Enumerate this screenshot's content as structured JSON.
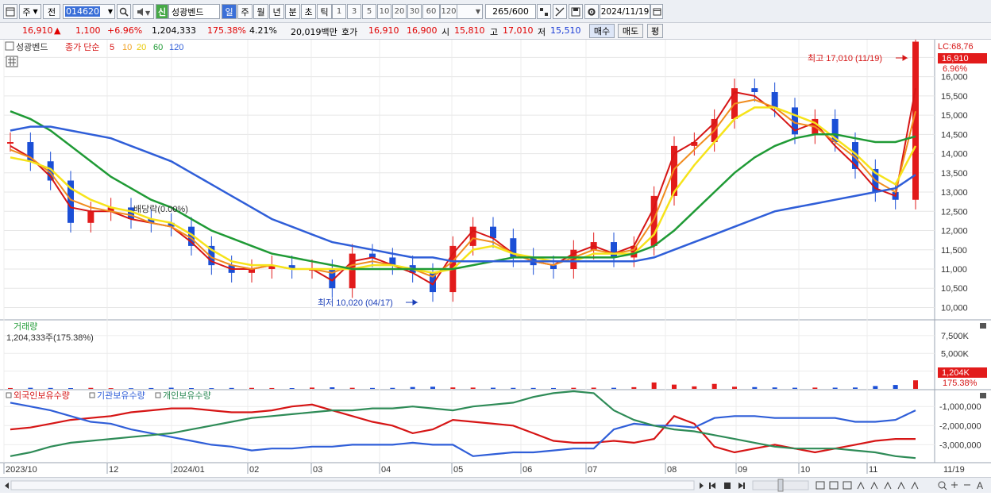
{
  "toolbar": {
    "market_btn": "주",
    "prev_btn": "전",
    "stock_code": "014620",
    "new_badge": "신",
    "stock_name": "성광벤드",
    "periods": [
      "일",
      "주",
      "월",
      "년",
      "분",
      "초",
      "틱"
    ],
    "active_period": "일",
    "intervals": [
      "1",
      "3",
      "5",
      "10",
      "20",
      "30",
      "60",
      "120"
    ],
    "count_value": "265",
    "count_total": "/600",
    "date_value": "2024/11/19"
  },
  "quote": {
    "price": "16,910",
    "arrow": "▲",
    "change": "1,100",
    "change_pct": "+6.96%",
    "volume": "1,204,333",
    "volume_ratio": "175.38%",
    "turnover": "4.21%",
    "amount": "20,019백만",
    "ask_label": "호가",
    "ask": "16,910",
    "bid": "16,900",
    "open_label": "시",
    "open": "15,810",
    "high_label": "고",
    "high": "17,010",
    "low_label": "저",
    "low": "15,510",
    "buy_btn": "매수",
    "sell_btn": "매도",
    "eval_btn": "평"
  },
  "price_panel": {
    "stock_label": "성광벤드",
    "series_label": "종가 단순",
    "ma_periods": [
      "5",
      "10",
      "20",
      "60",
      "120"
    ],
    "lc_label": "LC:68,76",
    "current_price": "16,910",
    "current_pct": "6.96%",
    "high_annotation": "최고 17,010 (11/19)",
    "low_annotation": "최저 10,020 (04/17)",
    "dividend_annotation": "배당락(0.00%)",
    "y_ticks": [
      "16,500",
      "16,000",
      "15,500",
      "15,000",
      "14,500",
      "14,000",
      "13,500",
      "13,000",
      "12,500",
      "12,000",
      "11,500",
      "11,000",
      "10,500",
      "10,000"
    ]
  },
  "volume_panel": {
    "title": "거래량",
    "value": "1,204,333주(175.38%)",
    "y_ticks": [
      "7,500K",
      "5,000K",
      "2,500K"
    ],
    "current": "1,204K",
    "current_pct": "175.38%"
  },
  "holdings_panel": {
    "series_labels": [
      "외국인보유수량",
      "기관보유수량",
      "개인보유수량"
    ],
    "y_ticks": [
      "-1,000,000",
      "-2,000,000",
      "-3,000,000"
    ]
  },
  "x_axis": {
    "labels": [
      "2023/10",
      "12",
      "2024/01",
      "02",
      "03",
      "04",
      "05",
      "06",
      "07",
      "08",
      "09",
      "10",
      "11"
    ],
    "right_label": "11/19"
  },
  "chart_data": {
    "type": "line",
    "title": "성광벤드",
    "series": [
      {
        "name": "종가",
        "values": [
          14.3,
          13.8,
          13.3,
          12.2,
          12.5,
          12.6,
          12.3,
          12.2,
          12.1,
          11.6,
          11.1,
          10.9,
          11.0,
          11.1,
          11.0,
          11.0,
          10.5,
          11.4,
          11.3,
          11.1,
          10.9,
          10.4,
          11.6,
          12.1,
          11.8,
          11.3,
          11.1,
          11.0,
          11.5,
          11.7,
          11.3,
          11.6,
          12.9,
          14.2,
          14.3,
          14.9,
          15.7,
          15.6,
          15.2,
          14.5,
          14.9,
          14.3,
          13.6,
          13.0,
          12.8,
          16.91
        ]
      },
      {
        "name": "5",
        "values": [
          14.2,
          13.9,
          13.4,
          12.6,
          12.5,
          12.5,
          12.3,
          12.2,
          12.1,
          11.7,
          11.2,
          11.0,
          11.0,
          11.1,
          11.0,
          11.0,
          10.7,
          11.2,
          11.3,
          11.1,
          10.9,
          10.6,
          11.4,
          12.0,
          11.8,
          11.4,
          11.2,
          11.1,
          11.4,
          11.6,
          11.4,
          11.6,
          12.6,
          14.0,
          14.3,
          14.8,
          15.6,
          15.5,
          15.1,
          14.6,
          14.8,
          14.2,
          13.7,
          13.1,
          12.9,
          15.7
        ]
      },
      {
        "name": "10",
        "values": [
          14.1,
          13.9,
          13.5,
          12.8,
          12.6,
          12.5,
          12.4,
          12.2,
          12.1,
          11.8,
          11.3,
          11.1,
          11.0,
          11.1,
          11.0,
          11.0,
          10.9,
          11.1,
          11.2,
          11.1,
          11.0,
          10.8,
          11.2,
          11.8,
          11.7,
          11.4,
          11.2,
          11.1,
          11.3,
          11.5,
          11.4,
          11.5,
          12.3,
          13.6,
          14.1,
          14.6,
          15.3,
          15.4,
          15.2,
          14.8,
          14.7,
          14.3,
          13.9,
          13.3,
          13.0,
          15.1
        ]
      },
      {
        "name": "20",
        "values": [
          13.9,
          13.8,
          13.6,
          13.1,
          12.8,
          12.6,
          12.5,
          12.3,
          12.2,
          11.9,
          11.5,
          11.2,
          11.1,
          11.1,
          11.0,
          11.0,
          11.0,
          11.0,
          11.1,
          11.1,
          11.0,
          10.9,
          11.0,
          11.5,
          11.6,
          11.4,
          11.3,
          11.2,
          11.2,
          11.4,
          11.4,
          11.4,
          11.9,
          13.0,
          13.7,
          14.3,
          14.9,
          15.2,
          15.2,
          15.0,
          14.8,
          14.4,
          14.0,
          13.5,
          13.2,
          14.2
        ]
      },
      {
        "name": "60",
        "values": [
          15.1,
          14.9,
          14.6,
          14.2,
          13.8,
          13.4,
          13.1,
          12.8,
          12.6,
          12.3,
          12.0,
          11.8,
          11.6,
          11.4,
          11.3,
          11.2,
          11.1,
          11.0,
          11.0,
          11.0,
          11.0,
          11.0,
          11.0,
          11.1,
          11.2,
          11.3,
          11.3,
          11.3,
          11.3,
          11.3,
          11.3,
          11.4,
          11.6,
          12.0,
          12.5,
          13.0,
          13.5,
          13.9,
          14.2,
          14.4,
          14.5,
          14.5,
          14.4,
          14.3,
          14.3,
          14.45
        ]
      },
      {
        "name": "120",
        "values": [
          14.6,
          14.7,
          14.7,
          14.6,
          14.5,
          14.4,
          14.2,
          14.0,
          13.8,
          13.5,
          13.2,
          12.9,
          12.6,
          12.3,
          12.1,
          11.9,
          11.7,
          11.6,
          11.5,
          11.4,
          11.3,
          11.3,
          11.2,
          11.2,
          11.2,
          11.2,
          11.2,
          11.2,
          11.2,
          11.2,
          11.2,
          11.2,
          11.3,
          11.5,
          11.7,
          11.9,
          12.1,
          12.3,
          12.5,
          12.6,
          12.7,
          12.8,
          12.9,
          13.0,
          13.1,
          13.45
        ]
      }
    ],
    "ylim": [
      9.7,
      16.9
    ],
    "volume": [
      120,
      150,
      130,
      110,
      140,
      100,
      90,
      120,
      160,
      110,
      100,
      130,
      140,
      120,
      110,
      180,
      220,
      150,
      130,
      140,
      260,
      300,
      200,
      180,
      160,
      140,
      130,
      120,
      150,
      170,
      150,
      240,
      900,
      600,
      350,
      700,
      300,
      250,
      200,
      160,
      180,
      170,
      190,
      400,
      550,
      1204
    ],
    "volume_ylim": [
      0,
      9500
    ],
    "holdings": {
      "foreign": [
        -2.2,
        -2.1,
        -1.9,
        -1.7,
        -1.6,
        -1.5,
        -1.3,
        -1.2,
        -1.1,
        -1.1,
        -1.2,
        -1.3,
        -1.3,
        -1.2,
        -1.0,
        -0.9,
        -1.2,
        -1.5,
        -1.8,
        -2.0,
        -2.4,
        -2.2,
        -1.7,
        -1.8,
        -1.9,
        -2.0,
        -2.4,
        -2.8,
        -2.9,
        -2.9,
        -2.8,
        -2.9,
        -2.7,
        -1.5,
        -1.9,
        -3.1,
        -3.4,
        -3.2,
        -3.0,
        -3.2,
        -3.4,
        -3.2,
        -3.0,
        -2.8,
        -2.7,
        -2.7
      ],
      "institution": [
        -0.8,
        -1.0,
        -1.2,
        -1.5,
        -1.8,
        -1.9,
        -2.2,
        -2.4,
        -2.6,
        -2.8,
        -3.0,
        -3.1,
        -3.3,
        -3.2,
        -3.2,
        -3.1,
        -3.1,
        -3.0,
        -3.0,
        -3.0,
        -2.9,
        -3.0,
        -3.0,
        -3.6,
        -3.5,
        -3.4,
        -3.4,
        -3.3,
        -3.2,
        -3.2,
        -2.2,
        -1.9,
        -2.0,
        -2.0,
        -2.1,
        -1.6,
        -1.5,
        -1.5,
        -1.6,
        -1.6,
        -1.6,
        -1.6,
        -1.8,
        -1.8,
        -1.7,
        -1.2
      ],
      "individual": [
        -3.6,
        -3.4,
        -3.1,
        -2.9,
        -2.8,
        -2.7,
        -2.6,
        -2.5,
        -2.4,
        -2.2,
        -2.0,
        -1.8,
        -1.6,
        -1.5,
        -1.4,
        -1.3,
        -1.2,
        -1.2,
        -1.1,
        -1.1,
        -1.0,
        -1.1,
        -1.2,
        -1.0,
        -0.9,
        -0.8,
        -0.5,
        -0.3,
        -0.2,
        -0.3,
        -1.2,
        -1.7,
        -2.0,
        -2.2,
        -2.3,
        -2.5,
        -2.7,
        -2.9,
        -3.1,
        -3.2,
        -3.2,
        -3.2,
        -3.3,
        -3.4,
        -3.6,
        -3.7
      ]
    },
    "holdings_ylim": [
      -3.9,
      -0.2
    ],
    "x_labels": [
      "2023/10",
      "12",
      "2024/01",
      "02",
      "03",
      "04",
      "05",
      "06",
      "07",
      "08",
      "09",
      "10",
      "11"
    ]
  }
}
